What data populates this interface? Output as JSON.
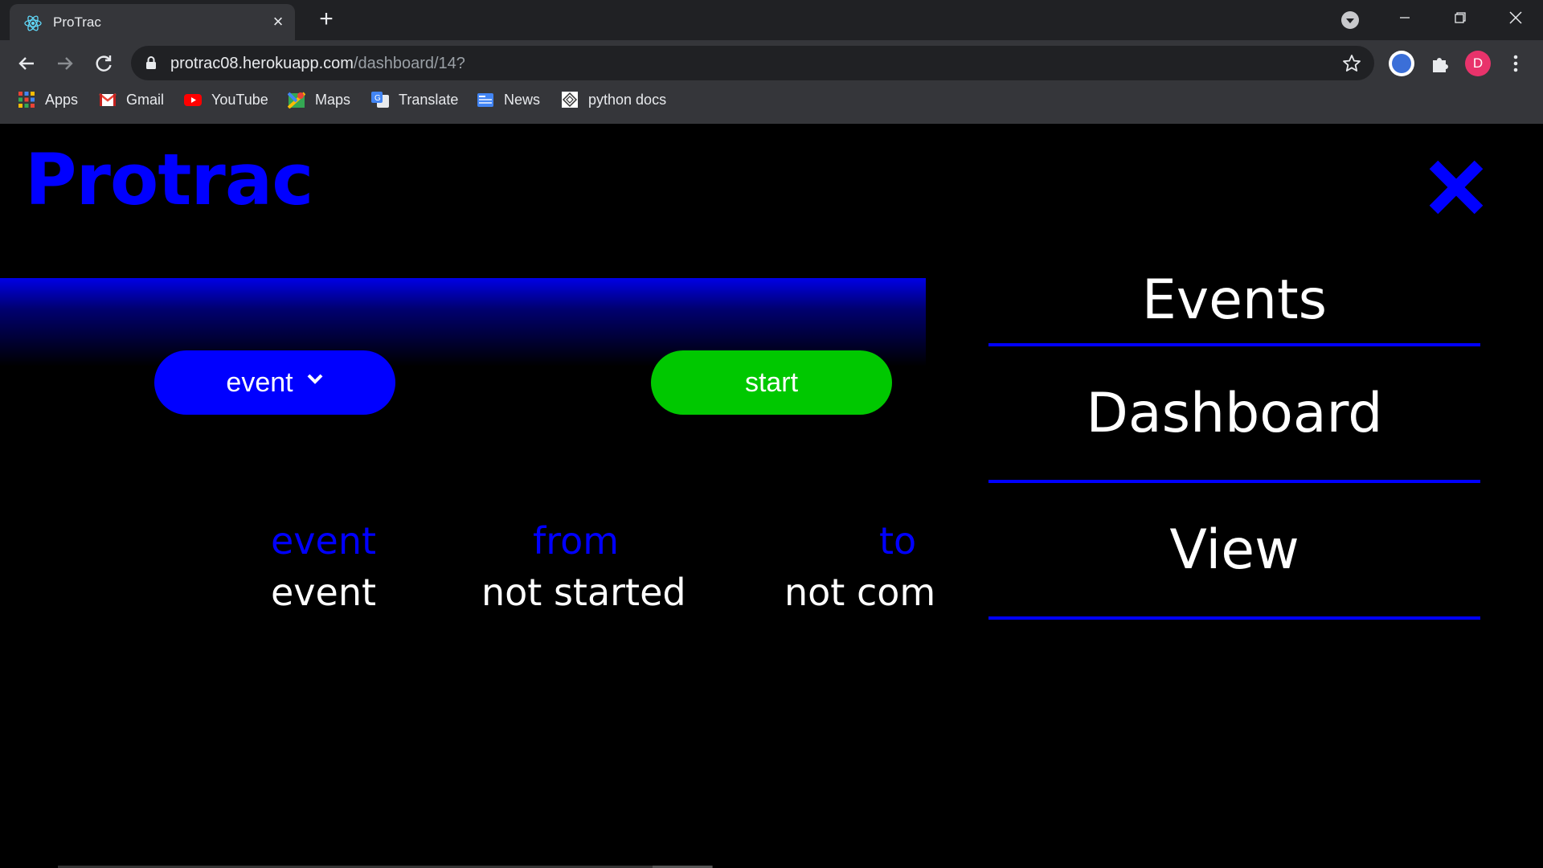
{
  "browser": {
    "tab_title": "ProTrac",
    "tab_close": "×",
    "new_tab": "+",
    "url_host": "protrac08.herokuapp.com",
    "url_path": "/dashboard/14?",
    "avatar_letter": "D",
    "bookmarks": [
      {
        "label": "Apps",
        "icon": "apps-grid-icon"
      },
      {
        "label": "Gmail",
        "icon": "gmail-icon"
      },
      {
        "label": "YouTube",
        "icon": "youtube-icon"
      },
      {
        "label": "Maps",
        "icon": "maps-icon"
      },
      {
        "label": "Translate",
        "icon": "translate-icon"
      },
      {
        "label": "News",
        "icon": "news-icon"
      },
      {
        "label": "python docs",
        "icon": "python-docs-icon"
      }
    ]
  },
  "app": {
    "logo": "Protrac",
    "event_select_label": "event",
    "start_label": "start",
    "columns": [
      {
        "header": "event",
        "value": "event"
      },
      {
        "header": "from",
        "value": "not started"
      },
      {
        "header": "to",
        "value": "not com"
      }
    ],
    "menu": [
      "Events",
      "Dashboard",
      "View"
    ]
  },
  "colors": {
    "brand_blue": "#0000ff",
    "start_green": "#00c800",
    "background": "#000000"
  }
}
